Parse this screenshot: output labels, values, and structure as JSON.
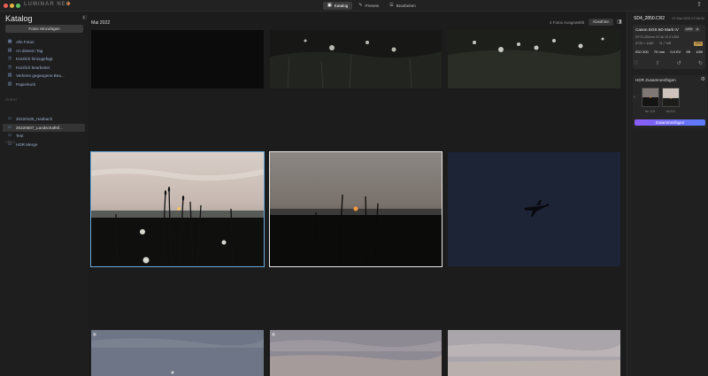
{
  "app": {
    "brand": "LUMINAR NEO",
    "tabs": [
      {
        "label": "Katalog",
        "icon": "catalog-icon",
        "active": true
      },
      {
        "label": "Presets",
        "icon": "presets-icon",
        "active": false
      },
      {
        "label": "Bearbeiten",
        "icon": "edit-icon",
        "active": false
      }
    ]
  },
  "sidebar": {
    "title": "Katalog",
    "add_button": "Fotos Hinzufügen",
    "items": [
      {
        "label": "Alle Fotos",
        "icon": "photos-icon"
      },
      {
        "label": "An diesem Tag",
        "icon": "calendar-icon"
      },
      {
        "label": "Kürzlich hinzugefügt",
        "icon": "clock-icon"
      },
      {
        "label": "Kürzlich bearbeitet",
        "icon": "clock-icon"
      },
      {
        "label": "Verloren gegangene Bea...",
        "icon": "lost-icon"
      },
      {
        "label": "Papierkorb",
        "icon": "trash-icon"
      }
    ],
    "folders_label": "Ordner",
    "albums": [
      {
        "label": "20220105_Hasbach",
        "icon": "folder-icon",
        "selected": false
      },
      {
        "label": "20220507_Landschaftsf...",
        "icon": "folder-icon",
        "selected": true
      },
      {
        "label": "Test",
        "icon": "folder-icon",
        "selected": false
      },
      {
        "label": "HDR Merge",
        "icon": "folder-icon",
        "selected": false
      }
    ],
    "albums_label": "Alben"
  },
  "main": {
    "month": "Mai 2022",
    "selection": "2 Fotos Ausgewählt",
    "deselect": "Abwählen"
  },
  "details": {
    "filename": "SD4_2850.CR2",
    "date": "07 Mai 2022 07:08:34",
    "camera": "Canon EOS 5D Mark IV",
    "chips": [
      "AWB",
      "⊘"
    ],
    "lens": "EF70-200mm f/2.8L IS II USM",
    "dimensions": "6720 × 4480",
    "filesize": "31,7 MB",
    "ext": "CR2",
    "iso": "ISO 200",
    "focal": "70 mm",
    "ev": "0.0 EV",
    "aperture": "f/8",
    "shutter": "1/80",
    "actions": [
      "heart-icon",
      "share-icon",
      "rotate-left-icon",
      "rotate-right-icon"
    ]
  },
  "hdr": {
    "title": "HDR Zusammenfügen",
    "ev_left": "ev -2.0",
    "ev_right": "ev 0.0",
    "merge_button": "Zusammenfügen"
  }
}
